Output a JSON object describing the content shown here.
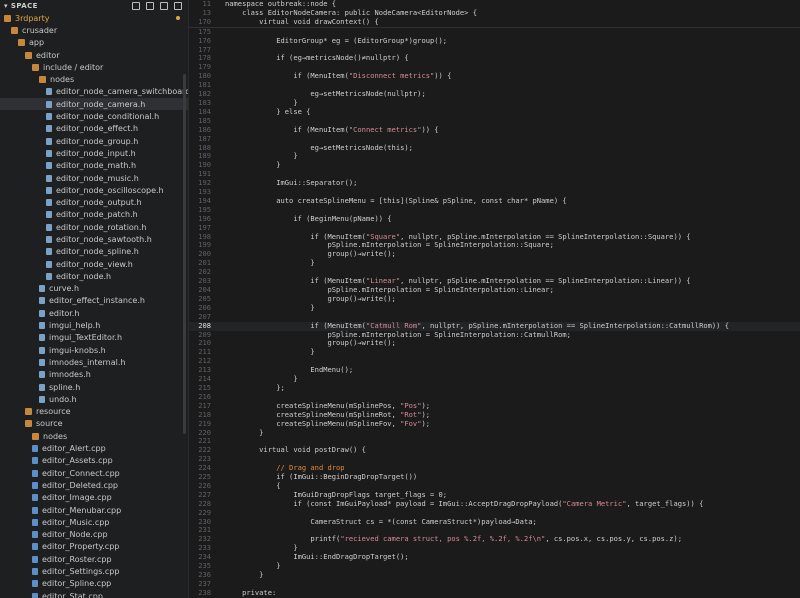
{
  "sidebar": {
    "header": "SPACE",
    "tools": [
      "new-file-icon",
      "new-folder-icon",
      "refresh-icon",
      "collapse-icon"
    ],
    "items": [
      {
        "label": "3rdparty",
        "depth": 0,
        "kind": "folder",
        "first": true,
        "dot": true
      },
      {
        "label": "crusader",
        "depth": 1,
        "kind": "folder"
      },
      {
        "label": "app",
        "depth": 2,
        "kind": "folder"
      },
      {
        "label": "editor",
        "depth": 3,
        "kind": "folder"
      },
      {
        "label": "include / editor",
        "depth": 4,
        "kind": "folder"
      },
      {
        "label": "nodes",
        "depth": 5,
        "kind": "folder"
      },
      {
        "label": "editor_node_camera_switchboard.h",
        "depth": 6,
        "kind": "file"
      },
      {
        "label": "editor_node_camera.h",
        "depth": 6,
        "kind": "file",
        "selected": true
      },
      {
        "label": "editor_node_conditional.h",
        "depth": 6,
        "kind": "file"
      },
      {
        "label": "editor_node_effect.h",
        "depth": 6,
        "kind": "file"
      },
      {
        "label": "editor_node_group.h",
        "depth": 6,
        "kind": "file"
      },
      {
        "label": "editor_node_input.h",
        "depth": 6,
        "kind": "file"
      },
      {
        "label": "editor_node_math.h",
        "depth": 6,
        "kind": "file"
      },
      {
        "label": "editor_node_music.h",
        "depth": 6,
        "kind": "file"
      },
      {
        "label": "editor_node_oscilloscope.h",
        "depth": 6,
        "kind": "file"
      },
      {
        "label": "editor_node_output.h",
        "depth": 6,
        "kind": "file"
      },
      {
        "label": "editor_node_patch.h",
        "depth": 6,
        "kind": "file"
      },
      {
        "label": "editor_node_rotation.h",
        "depth": 6,
        "kind": "file"
      },
      {
        "label": "editor_node_sawtooth.h",
        "depth": 6,
        "kind": "file"
      },
      {
        "label": "editor_node_spline.h",
        "depth": 6,
        "kind": "file"
      },
      {
        "label": "editor_node_view.h",
        "depth": 6,
        "kind": "file"
      },
      {
        "label": "editor_node.h",
        "depth": 6,
        "kind": "file"
      },
      {
        "label": "curve.h",
        "depth": 5,
        "kind": "file"
      },
      {
        "label": "editor_effect_instance.h",
        "depth": 5,
        "kind": "file"
      },
      {
        "label": "editor.h",
        "depth": 5,
        "kind": "file"
      },
      {
        "label": "imgui_help.h",
        "depth": 5,
        "kind": "file"
      },
      {
        "label": "imgui_TextEditor.h",
        "depth": 5,
        "kind": "file"
      },
      {
        "label": "imgui-knobs.h",
        "depth": 5,
        "kind": "file"
      },
      {
        "label": "imnodes_internal.h",
        "depth": 5,
        "kind": "file"
      },
      {
        "label": "imnodes.h",
        "depth": 5,
        "kind": "file"
      },
      {
        "label": "spline.h",
        "depth": 5,
        "kind": "file"
      },
      {
        "label": "undo.h",
        "depth": 5,
        "kind": "file"
      },
      {
        "label": "resource",
        "depth": 3,
        "kind": "folder"
      },
      {
        "label": "source",
        "depth": 3,
        "kind": "folder"
      },
      {
        "label": "nodes",
        "depth": 4,
        "kind": "folder"
      },
      {
        "label": "editor_Alert.cpp",
        "depth": 4,
        "kind": "cpp"
      },
      {
        "label": "editor_Assets.cpp",
        "depth": 4,
        "kind": "cpp"
      },
      {
        "label": "editor_Connect.cpp",
        "depth": 4,
        "kind": "cpp"
      },
      {
        "label": "editor_Deleted.cpp",
        "depth": 4,
        "kind": "cpp"
      },
      {
        "label": "editor_Image.cpp",
        "depth": 4,
        "kind": "cpp"
      },
      {
        "label": "editor_Menubar.cpp",
        "depth": 4,
        "kind": "cpp"
      },
      {
        "label": "editor_Music.cpp",
        "depth": 4,
        "kind": "cpp"
      },
      {
        "label": "editor_Node.cpp",
        "depth": 4,
        "kind": "cpp"
      },
      {
        "label": "editor_Property.cpp",
        "depth": 4,
        "kind": "cpp"
      },
      {
        "label": "editor_Roster.cpp",
        "depth": 4,
        "kind": "cpp"
      },
      {
        "label": "editor_Settings.cpp",
        "depth": 4,
        "kind": "cpp"
      },
      {
        "label": "editor_Spline.cpp",
        "depth": 4,
        "kind": "cpp"
      },
      {
        "label": "editor_Stat.cpp",
        "depth": 4,
        "kind": "cpp"
      }
    ]
  },
  "editor": {
    "current_line": 208,
    "sticky": [
      {
        "n": "11",
        "t": "namespace outbreak::node {"
      },
      {
        "n": "13",
        "t": "    class EditorNodeCamera: public NodeCamera<EditorNode> {"
      },
      {
        "n": "170",
        "t": "        virtual void drawContext() {"
      }
    ],
    "lines": [
      {
        "n": "175",
        "t": ""
      },
      {
        "n": "176",
        "t": "            EditorGroup* eg = (EditorGroup*)group();"
      },
      {
        "n": "177",
        "t": ""
      },
      {
        "n": "178",
        "t": "            if (eg→metricsNode()≠nullptr) {"
      },
      {
        "n": "179",
        "t": ""
      },
      {
        "n": "180",
        "t": "                if (MenuItem(\"Disconnect metrics\")) {"
      },
      {
        "n": "181",
        "t": ""
      },
      {
        "n": "182",
        "t": "                    eg→setMetricsNode(nullptr);"
      },
      {
        "n": "183",
        "t": "                }"
      },
      {
        "n": "184",
        "t": "            } else {"
      },
      {
        "n": "185",
        "t": ""
      },
      {
        "n": "186",
        "t": "                if (MenuItem(\"Connect metrics\")) {"
      },
      {
        "n": "187",
        "t": ""
      },
      {
        "n": "188",
        "t": "                    eg→setMetricsNode(this);"
      },
      {
        "n": "189",
        "t": "                }"
      },
      {
        "n": "190",
        "t": "            }"
      },
      {
        "n": "191",
        "t": ""
      },
      {
        "n": "192",
        "t": "            ImGui::Separator();"
      },
      {
        "n": "193",
        "t": ""
      },
      {
        "n": "194",
        "t": "            auto createSplineMenu = [this](Spline& pSpline, const char* pName) {"
      },
      {
        "n": "195",
        "t": ""
      },
      {
        "n": "196",
        "t": "                if (BeginMenu(pName)) {"
      },
      {
        "n": "197",
        "t": ""
      },
      {
        "n": "198",
        "t": "                    if (MenuItem(\"Square\", nullptr, pSpline.mInterpolation == SplineInterpolation::Square)) {"
      },
      {
        "n": "199",
        "t": "                        pSpline.mInterpolation = SplineInterpolation::Square;"
      },
      {
        "n": "200",
        "t": "                        group()→write();"
      },
      {
        "n": "201",
        "t": "                    }"
      },
      {
        "n": "202",
        "t": ""
      },
      {
        "n": "203",
        "t": "                    if (MenuItem(\"Linear\", nullptr, pSpline.mInterpolation == SplineInterpolation::Linear)) {"
      },
      {
        "n": "204",
        "t": "                        pSpline.mInterpolation = SplineInterpolation::Linear;"
      },
      {
        "n": "205",
        "t": "                        group()→write();"
      },
      {
        "n": "206",
        "t": "                    }"
      },
      {
        "n": "207",
        "t": ""
      },
      {
        "n": "208",
        "t": "                    if (MenuItem(\"Catmull Rom\", nullptr, pSpline.mInterpolation == SplineInterpolation::CatmullRom)) {"
      },
      {
        "n": "209",
        "t": "                        pSpline.mInterpolation = SplineInterpolation::CatmullRom;"
      },
      {
        "n": "210",
        "t": "                        group()→write();"
      },
      {
        "n": "211",
        "t": "                    }"
      },
      {
        "n": "212",
        "t": ""
      },
      {
        "n": "213",
        "t": "                    EndMenu();"
      },
      {
        "n": "214",
        "t": "                }"
      },
      {
        "n": "215",
        "t": "            };"
      },
      {
        "n": "216",
        "t": ""
      },
      {
        "n": "217",
        "t": "            createSplineMenu(mSplinePos, \"Pos\");"
      },
      {
        "n": "218",
        "t": "            createSplineMenu(mSplineRot, \"Rot\");"
      },
      {
        "n": "219",
        "t": "            createSplineMenu(mSplineFov, \"Fov\");"
      },
      {
        "n": "220",
        "t": "        }"
      },
      {
        "n": "221",
        "t": ""
      },
      {
        "n": "222",
        "t": "        virtual void postDraw() {"
      },
      {
        "n": "223",
        "t": ""
      },
      {
        "n": "224",
        "t": "            // Drag and drop"
      },
      {
        "n": "225",
        "t": "            if (ImGui::BeginDragDropTarget())"
      },
      {
        "n": "226",
        "t": "            {"
      },
      {
        "n": "227",
        "t": "                ImGuiDragDropFlags target_flags = 0;"
      },
      {
        "n": "228",
        "t": "                if (const ImGuiPayload* payload = ImGui::AcceptDragDropPayload(\"Camera Metric\", target_flags)) {"
      },
      {
        "n": "229",
        "t": ""
      },
      {
        "n": "230",
        "t": "                    CameraStruct cs = *(const CameraStruct*)payload→Data;"
      },
      {
        "n": "231",
        "t": ""
      },
      {
        "n": "232",
        "t": "                    printf(\"recieved camera struct, pos %.2f, %.2f, %.2f\\n\", cs.pos.x, cs.pos.y, cs.pos.z);"
      },
      {
        "n": "233",
        "t": "                }"
      },
      {
        "n": "234",
        "t": "                ImGui::EndDragDropTarget();"
      },
      {
        "n": "235",
        "t": "            }"
      },
      {
        "n": "236",
        "t": "        }"
      },
      {
        "n": "237",
        "t": ""
      },
      {
        "n": "238",
        "t": "    private:"
      }
    ]
  }
}
